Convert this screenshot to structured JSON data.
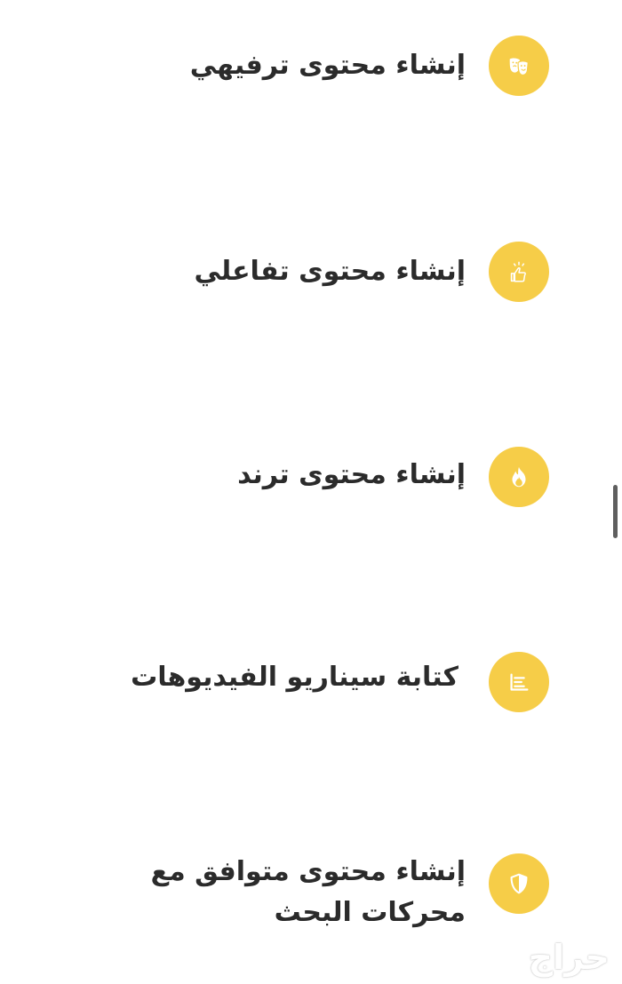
{
  "services": [
    {
      "title": "إنشاء محتوى ترفيهي",
      "icon": "theater-masks-icon"
    },
    {
      "title": "إنشاء محتوى تفاعلي",
      "icon": "thumbs-up-spark-icon"
    },
    {
      "title": "إنشاء محتوى ترند",
      "icon": "fire-icon"
    },
    {
      "title": "كتابة سيناريو الفيديوهات",
      "icon": "script-lines-icon"
    },
    {
      "title": "إنشاء محتوى متوافق مع محركات البحث",
      "icon": "shield-icon"
    }
  ],
  "watermark": "حراج",
  "colors": {
    "accent": "#f6cd48",
    "text": "#2b2b2b",
    "background": "#ffffff",
    "scrollbar": "#5f5f5f"
  }
}
